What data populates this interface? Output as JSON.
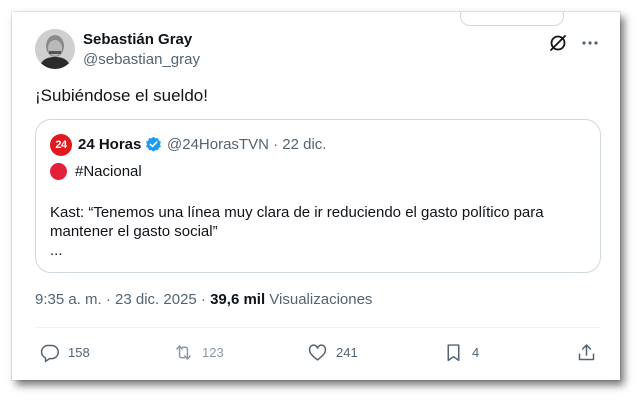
{
  "author": {
    "name": "Sebastián Gray",
    "handle": "@sebastian_gray"
  },
  "tweet": {
    "text": "¡Subiéndose el sueldo!"
  },
  "quoted": {
    "logo_text": "24",
    "name": "24 Horas",
    "meta": "@24HorasTVN · 22 dic.",
    "tag": "#Nacional",
    "body": "Kast: “Tenemos una línea muy clara de ir reduciendo el gasto político para mantener el gasto social”",
    "ellipsis": "...",
    "logo_color": "#e0191f"
  },
  "stats": {
    "timestamp": "9:35 a. m. · 23 dic. 2025 · ",
    "views_count": "39,6 mil",
    "views_label": " Visualizaciones"
  },
  "actions": {
    "replies": "158",
    "retweets": "123",
    "likes": "241",
    "bookmarks": "4"
  },
  "icons": [
    "grok-icon",
    "more-icon",
    "verified-badge-icon",
    "reply-icon",
    "retweet-icon",
    "like-icon",
    "bookmark-icon",
    "share-icon"
  ]
}
